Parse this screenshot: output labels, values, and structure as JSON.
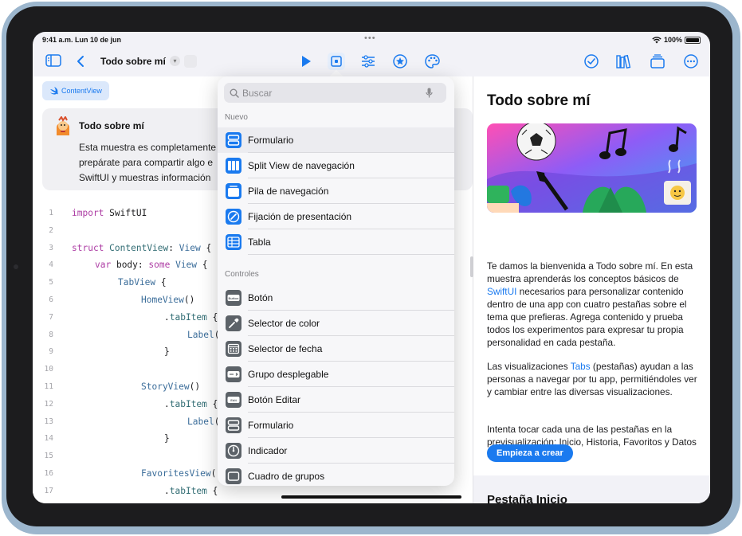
{
  "status": {
    "time": "9:41 a.m.  Lun 10 de jun",
    "dots": "•••",
    "battery": "100%",
    "battery_level": 1.0
  },
  "toolbar": {
    "title": "Todo sobre mí"
  },
  "editor": {
    "file_tab": "ContentView",
    "card_title": "Todo sobre mí",
    "card_text": [
      "Esta muestra es completamente",
      "prepárate para compartir algo e",
      "SwiftUI y muestras información"
    ],
    "code": [
      {
        "n": "1",
        "indent": 0,
        "tokens": [
          [
            "kw",
            "import"
          ],
          [
            "nm",
            " SwiftUI"
          ]
        ]
      },
      {
        "n": "2",
        "indent": 0,
        "tokens": []
      },
      {
        "n": "3",
        "indent": 0,
        "tokens": [
          [
            "kw",
            "struct"
          ],
          [
            "nm",
            " "
          ],
          [
            "fn",
            "ContentView"
          ],
          [
            "nm",
            ": "
          ],
          [
            "ty",
            "View"
          ],
          [
            "nm",
            " {"
          ]
        ]
      },
      {
        "n": "4",
        "indent": 1,
        "tokens": [
          [
            "kw",
            "var"
          ],
          [
            "nm",
            " body: "
          ],
          [
            "kw",
            "some"
          ],
          [
            "nm",
            " "
          ],
          [
            "ty",
            "View"
          ],
          [
            "nm",
            " {"
          ]
        ]
      },
      {
        "n": "5",
        "indent": 2,
        "tokens": [
          [
            "ty",
            "TabView"
          ],
          [
            "nm",
            " {"
          ]
        ]
      },
      {
        "n": "6",
        "indent": 3,
        "tokens": [
          [
            "ty",
            "HomeView"
          ],
          [
            "nm",
            "()"
          ]
        ]
      },
      {
        "n": "7",
        "indent": 4,
        "tokens": [
          [
            "nm",
            "."
          ],
          [
            "fn",
            "tabItem"
          ],
          [
            "nm",
            " {"
          ]
        ]
      },
      {
        "n": "8",
        "indent": 5,
        "tokens": [
          [
            "ty",
            "Label"
          ],
          [
            "nm",
            "("
          ]
        ]
      },
      {
        "n": "9",
        "indent": 4,
        "tokens": [
          [
            "nm",
            "}"
          ]
        ]
      },
      {
        "n": "10",
        "indent": 0,
        "tokens": []
      },
      {
        "n": "11",
        "indent": 3,
        "tokens": [
          [
            "ty",
            "StoryView"
          ],
          [
            "nm",
            "()"
          ]
        ]
      },
      {
        "n": "12",
        "indent": 4,
        "tokens": [
          [
            "nm",
            "."
          ],
          [
            "fn",
            "tabItem"
          ],
          [
            "nm",
            " {"
          ]
        ]
      },
      {
        "n": "13",
        "indent": 5,
        "tokens": [
          [
            "ty",
            "Label"
          ],
          [
            "nm",
            "("
          ]
        ]
      },
      {
        "n": "14",
        "indent": 4,
        "tokens": [
          [
            "nm",
            "}"
          ]
        ]
      },
      {
        "n": "15",
        "indent": 0,
        "tokens": []
      },
      {
        "n": "16",
        "indent": 3,
        "tokens": [
          [
            "ty",
            "FavoritesView"
          ],
          [
            "nm",
            "("
          ]
        ]
      },
      {
        "n": "17",
        "indent": 4,
        "tokens": [
          [
            "nm",
            "."
          ],
          [
            "fn",
            "tabItem"
          ],
          [
            "nm",
            " {"
          ]
        ]
      }
    ]
  },
  "library": {
    "search_placeholder": "Buscar",
    "section_new": "Nuevo",
    "new_items": [
      {
        "name": "formulario-item",
        "label": "Formulario",
        "icon": "form-icon",
        "color": "blue"
      },
      {
        "name": "split-view-item",
        "label": "Split View de navegación",
        "icon": "split-view-icon",
        "color": "blue"
      },
      {
        "name": "navigation-stack-item",
        "label": "Pila de navegación",
        "icon": "stack-icon",
        "color": "blue"
      },
      {
        "name": "presentation-detent-item",
        "label": "Fijación de presentación",
        "icon": "pin-icon",
        "color": "blue"
      },
      {
        "name": "table-item",
        "label": "Tabla",
        "icon": "table-icon",
        "color": "blue"
      }
    ],
    "section_controls": "Controles",
    "control_items": [
      {
        "name": "button-item",
        "label": "Botón",
        "icon": "button-icon",
        "color": "gray",
        "glyph": "Button"
      },
      {
        "name": "color-picker-item",
        "label": "Selector de color",
        "icon": "eyedropper-icon",
        "color": "gray"
      },
      {
        "name": "date-picker-item",
        "label": "Selector de fecha",
        "icon": "calendar-icon",
        "color": "gray"
      },
      {
        "name": "disclosure-group-item",
        "label": "Grupo desplegable",
        "icon": "disclosure-icon",
        "color": "gray"
      },
      {
        "name": "edit-button-item",
        "label": "Botón Editar",
        "icon": "edit-button-icon",
        "color": "gray",
        "glyph": "Edit"
      },
      {
        "name": "form-control-item",
        "label": "Formulario",
        "icon": "form-icon",
        "color": "gray"
      },
      {
        "name": "gauge-item",
        "label": "Indicador",
        "icon": "gauge-icon",
        "color": "gray"
      },
      {
        "name": "group-box-item",
        "label": "Cuadro de grupos",
        "icon": "group-box-icon",
        "color": "gray"
      }
    ]
  },
  "preview": {
    "title": "Todo sobre mí",
    "p1_a": "Te damos la bienvenida a Todo sobre mí. En esta muestra aprenderás los conceptos básicos de ",
    "p1_link": "SwiftUI",
    "p1_b": " necesarios para personalizar contenido dentro de una app con cuatro pestañas sobre el tema que prefieras. Agrega contenido y prueba todos los experimentos para expresar tu propia personalidad en cada pestaña.",
    "p2_a": "Las visualizaciones ",
    "p2_link": "Tabs",
    "p2_b": " (pestañas) ayudan a las personas a navegar por tu app, permitiéndoles ver y cambiar entre las diversas visualizaciones.",
    "p3": "Intenta tocar cada una de las pestañas en la previsualización: Inicio, Historia, Favoritos y Datos curiosos.",
    "start_button": "Empieza a crear",
    "next_section": "Pestaña Inicio"
  },
  "colors": {
    "accent": "#1a7aef",
    "frame": "#9cb6cd",
    "bezel": "#1c1c1e"
  }
}
